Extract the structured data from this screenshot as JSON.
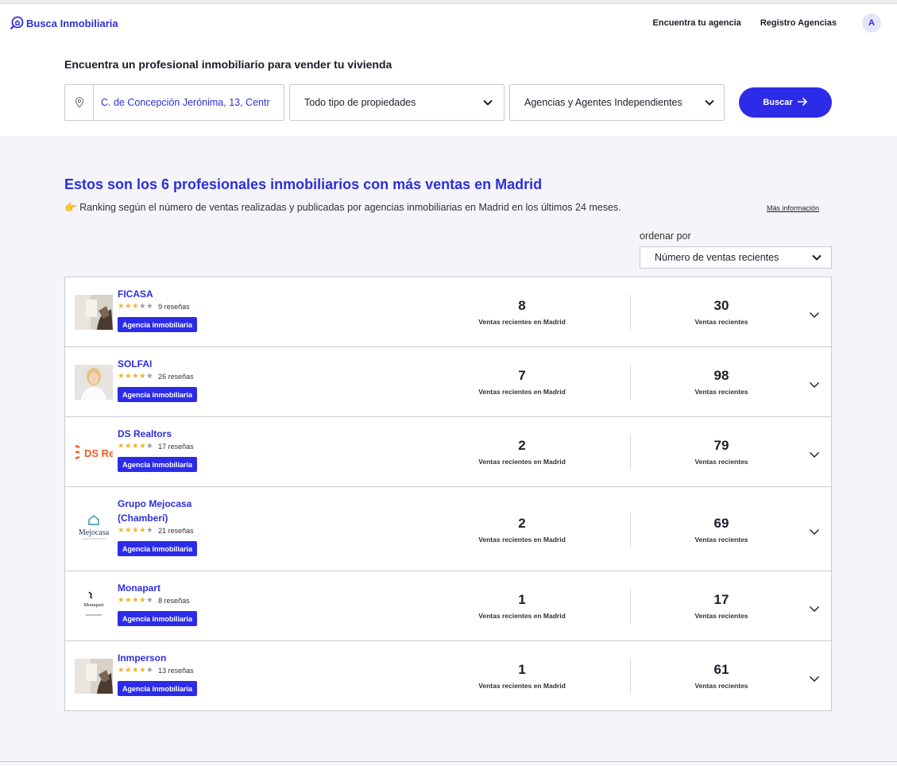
{
  "header": {
    "logo_text": "Busca Inmobiliaria",
    "nav": [
      "Encuentra tu agencia",
      "Registro Agencias"
    ],
    "avatar_initial": "A"
  },
  "search": {
    "title": "Encuentra un profesional inmobiliario para vender tu vivienda",
    "location_value": "C. de Concepción Jerónima, 13, Centr",
    "property_type": "Todo tipo de propiedades",
    "agent_type": "Agencias y Agentes Independientes",
    "button_label": "Buscar"
  },
  "ranking": {
    "title": "Estos son los 6 profesionales inmobiliarios con más ventas en Madrid",
    "subtitle_emoji": "👉",
    "subtitle": "Ranking según el número de ventas realizadas y publicadas por agencias inmobiliarias en Madrid en los últimos 24 meses.",
    "more_info": "Más información",
    "order_label": "ordenar por",
    "order_value": "Número de ventas recientes",
    "stat1_label": "Ventas recientes en Madrid",
    "stat2_label": "Ventas recientes",
    "badge_label": "Agencia inmobiliaria"
  },
  "agencies": [
    {
      "name": "FICASA",
      "rating": 3,
      "reviews": "9 reseñas",
      "madrid_sales": "8",
      "recent_sales": "30",
      "thumb": "room-photo"
    },
    {
      "name": "SOLFAI",
      "rating": 4,
      "reviews": "26 reseñas",
      "madrid_sales": "7",
      "recent_sales": "98",
      "thumb": "agent-portrait"
    },
    {
      "name": "DS Realtors",
      "rating": 4,
      "reviews": "17 reseñas",
      "madrid_sales": "2",
      "recent_sales": "79",
      "thumb": "ds-logo",
      "logo_text": "DS Real"
    },
    {
      "name": "Grupo Mejocasa (Chamberí)",
      "rating": 4,
      "reviews": "21 reseñas",
      "madrid_sales": "2",
      "recent_sales": "69",
      "thumb": "mejocasa-logo",
      "logo_text": "Mejocasa"
    },
    {
      "name": "Monapart",
      "rating": 4,
      "reviews": "8 reseñas",
      "madrid_sales": "1",
      "recent_sales": "17",
      "thumb": "monapart-logo",
      "logo_text": "Monapart"
    },
    {
      "name": "Inmperson",
      "rating": 4,
      "reviews": "13 reseñas",
      "madrid_sales": "1",
      "recent_sales": "61",
      "thumb": "room-photo"
    }
  ],
  "colors": {
    "brand": "#2e2fd9",
    "button": "#2c2ce8",
    "star": "#f3b51b"
  }
}
